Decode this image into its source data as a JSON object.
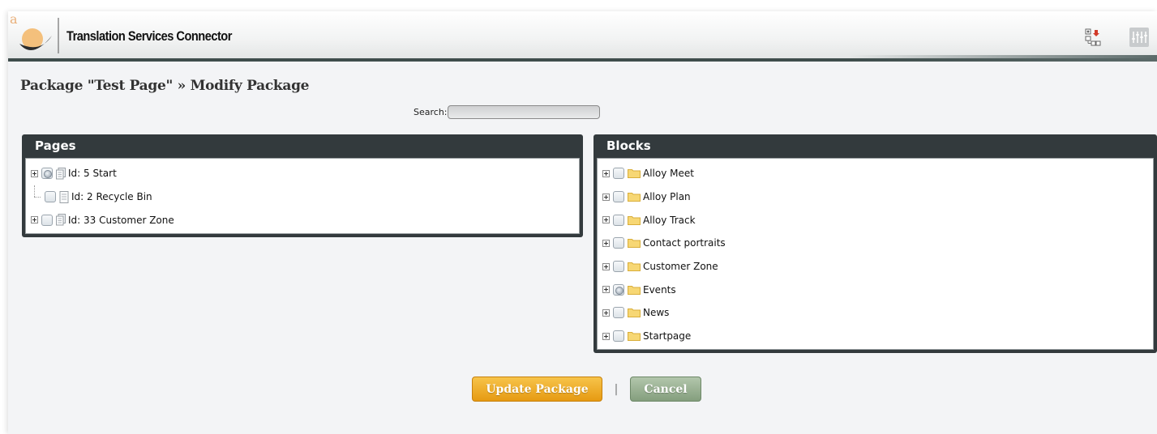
{
  "header": {
    "app_title": "Translation Services Connector",
    "logo_letter": "a",
    "icons": [
      "tree-structure-icon",
      "tuning-sliders-icon"
    ]
  },
  "page": {
    "title": "Package \"Test Page\" » Modify Package"
  },
  "search": {
    "label": "Search:",
    "value": "",
    "placeholder": ""
  },
  "pages_panel": {
    "title": "Pages",
    "items": [
      {
        "label": "Id: 5 Start",
        "expandable": true,
        "state": "partial",
        "icon": "page-stack-icon"
      },
      {
        "label": "Id: 2 Recycle Bin",
        "expandable": false,
        "state": "unchecked",
        "icon": "page-icon"
      },
      {
        "label": "Id: 33 Customer Zone",
        "expandable": true,
        "state": "unchecked",
        "icon": "page-stack-icon"
      }
    ]
  },
  "blocks_panel": {
    "title": "Blocks",
    "items": [
      {
        "label": "Alloy Meet",
        "state": "unchecked"
      },
      {
        "label": "Alloy Plan",
        "state": "unchecked"
      },
      {
        "label": "Alloy Track",
        "state": "unchecked"
      },
      {
        "label": "Contact portraits",
        "state": "unchecked"
      },
      {
        "label": "Customer Zone",
        "state": "unchecked"
      },
      {
        "label": "Events",
        "state": "partial"
      },
      {
        "label": "News",
        "state": "unchecked"
      },
      {
        "label": "Startpage",
        "state": "unchecked"
      }
    ]
  },
  "actions": {
    "update_label": "Update Package",
    "separator": "|",
    "cancel_label": "Cancel"
  },
  "colors": {
    "panel_header": "#333a3d",
    "update_button": "#f0ad2a",
    "cancel_button": "#9bb394",
    "header_rule": "#3f4d4c"
  }
}
